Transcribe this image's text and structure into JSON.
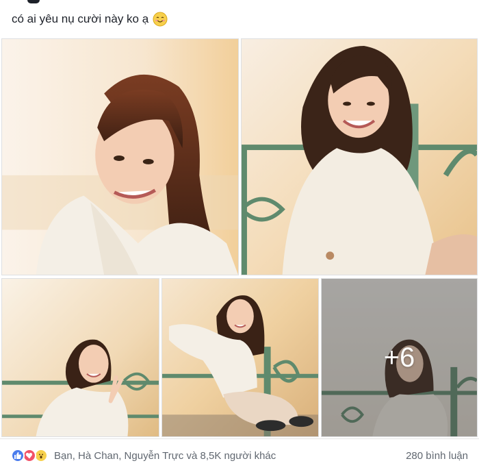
{
  "post": {
    "caption": "có ai yêu nụ cười này ko ạ",
    "caption_emoji": "smiling-face-emoji"
  },
  "gallery": {
    "photos": [
      {
        "name": "photo-1",
        "alt": "smiling girl portrait"
      },
      {
        "name": "photo-2",
        "alt": "girl sitting on railing"
      },
      {
        "name": "photo-3",
        "alt": "girl making v-sign"
      },
      {
        "name": "photo-4",
        "alt": "girl sitting on bench"
      },
      {
        "name": "photo-5",
        "alt": "girl in mist"
      }
    ],
    "more_count": "+6"
  },
  "footer": {
    "reaction_icons": [
      "like-icon",
      "love-icon",
      "wow-icon"
    ],
    "reactions_text": "Bạn, Hà Chan, Nguyễn Trực và 8,5K người khác",
    "comments_text": "280 bình luận"
  },
  "colors": {
    "like": "#4a7ced",
    "love": "#f25268",
    "wow": "#f7d04c",
    "secondary_text": "#606770"
  }
}
